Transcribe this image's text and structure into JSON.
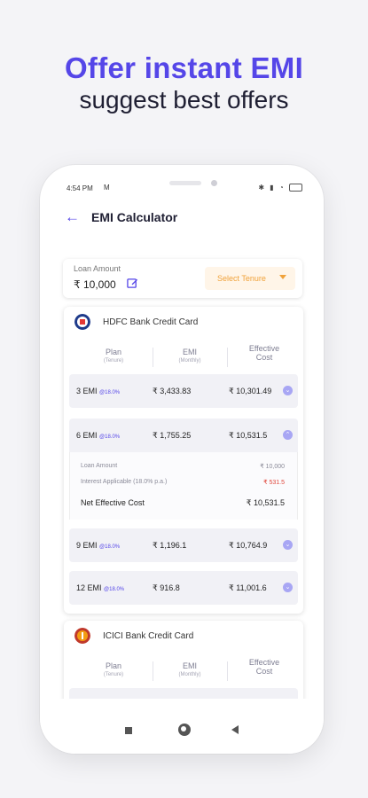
{
  "promo": {
    "headline": "Offer instant EMI",
    "subheadline": "suggest best offers"
  },
  "status_bar": {
    "time": "4:54 PM",
    "mail_icon": "M"
  },
  "app_bar": {
    "title": "EMI Calculator",
    "back_icon": "arrow-left-icon"
  },
  "loan": {
    "label": "Loan Amount",
    "value": "₹ 10,000",
    "tenure_button": "Select Tenure"
  },
  "table_headers": {
    "plan": "Plan",
    "plan_sub": "(Tenure)",
    "emi": "EMI",
    "emi_sub": "(Monthly)",
    "eff1": "Effective",
    "eff2": "Cost"
  },
  "banks": [
    {
      "name": "HDFC Bank Credit Card",
      "rows": [
        {
          "plan": "3 EMI",
          "rate": "@18.0%",
          "emi": "₹ 3,433.83",
          "eff": "₹ 10,301.49"
        },
        {
          "plan": "6 EMI",
          "rate": "@18.0%",
          "emi": "₹ 1,755.25",
          "eff": "₹ 10,531.5"
        },
        {
          "plan": "9 EMI",
          "rate": "@18.0%",
          "emi": "₹ 1,196.1",
          "eff": "₹ 10,764.9"
        },
        {
          "plan": "12 EMI",
          "rate": "@18.0%",
          "emi": "₹ 916.8",
          "eff": "₹ 11,001.6"
        }
      ],
      "detail": {
        "loan_label": "Loan Amount",
        "loan_value": "₹ 10,000",
        "interest_label": "Interest Applicable (18.0% p.a.)",
        "interest_value": "₹ 531.5",
        "net_label": "Net Effective Cost",
        "net_value": "₹ 10,531.5"
      }
    },
    {
      "name": "ICICI Bank Credit Card"
    }
  ],
  "colors": {
    "accent": "#5546e8",
    "tenure": "#f0a23a",
    "red": "#e0483d"
  }
}
